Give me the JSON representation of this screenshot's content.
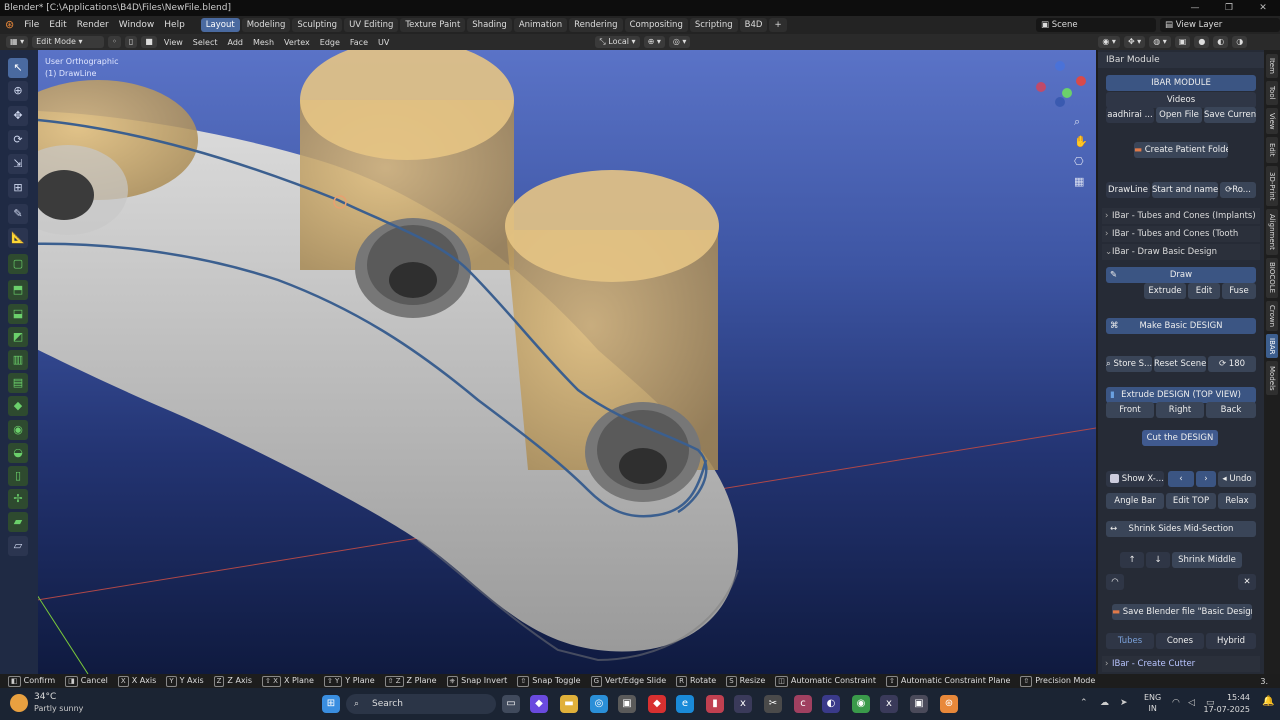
{
  "titlebar": {
    "title": "Blender* [C:\\Applications\\B4D\\Files\\NewFile.blend]",
    "minimize": "—",
    "maximize": "❐",
    "close": "✕"
  },
  "menus": [
    "File",
    "Edit",
    "Render",
    "Window",
    "Help"
  ],
  "workspace_tabs": [
    "Layout",
    "Modeling",
    "Sculpting",
    "UV Editing",
    "Texture Paint",
    "Shading",
    "Animation",
    "Rendering",
    "Compositing",
    "Scripting",
    "B4D"
  ],
  "add_tab": "+",
  "scene": {
    "label": "Scene",
    "view_layer": "View Layer"
  },
  "header": {
    "mode": "Edit Mode",
    "items": [
      "View",
      "Select",
      "Add",
      "Mesh",
      "Vertex",
      "Edge",
      "Face",
      "UV"
    ],
    "transform_orientation": "Local"
  },
  "viewport": {
    "view_name": "User Orthographic",
    "object_name": "(1) DrawLine"
  },
  "npanel": {
    "header": "IBar Module",
    "module_title": "IBAR MODULE",
    "videos": "Videos",
    "user": "aadhirai ...",
    "open_file": "Open File",
    "save_current": "Save Current",
    "create_patient_folder": "Create Patient Folder",
    "drawline": "DrawLine",
    "start_and_name": "Start and name H...",
    "ro": "Ro...",
    "sections": [
      "IBar - Tubes and Cones (Implants)",
      "IBar - Tubes and Cones (Tooth Preps)",
      "IBar - Draw Basic Design"
    ],
    "draw": "Draw",
    "extrude": "Extrude",
    "edit": "Edit",
    "fuse": "Fuse",
    "make_basic_design": "Make Basic DESIGN",
    "store_s": "Store S...",
    "reset_scene": "Reset Scene",
    "rotate_value": "180",
    "extrude_design": "Extrude DESIGN (TOP VIEW)",
    "front": "Front",
    "right": "Right",
    "back": "Back",
    "cut_design": "Cut the DESIGN",
    "show_x": "Show X-...",
    "undo": "Undo",
    "angle_bar": "Angle Bar",
    "edit_top": "Edit TOP",
    "relax": "Relax",
    "shrink_sides": "Shrink Sides Mid-Section",
    "shrink_middle": "Shrink Middle",
    "save_blender": "Save Blender file \"Basic Design\"",
    "tubes": "Tubes",
    "cones": "Cones",
    "hybrid": "Hybrid",
    "create_cutter": "IBar - Create Cutter",
    "vertical_tabs": [
      "Item",
      "Tool",
      "View",
      "Edit",
      "3D-Print",
      "Alignment",
      "BIOCOLE",
      "Crown",
      "IBAR",
      "Models"
    ]
  },
  "statusbar": [
    {
      "key": "",
      "label": "Confirm"
    },
    {
      "key": "",
      "label": "Cancel"
    },
    {
      "key": "X",
      "label": "X Axis"
    },
    {
      "key": "Y",
      "label": "Y Axis"
    },
    {
      "key": "Z",
      "label": "Z Axis"
    },
    {
      "key": "⇧ X",
      "label": "X Plane"
    },
    {
      "key": "⇧ Y",
      "label": "Y Plane"
    },
    {
      "key": "⇧ Z",
      "label": "Z Plane"
    },
    {
      "key": "",
      "label": "Snap Invert"
    },
    {
      "key": "⇧",
      "label": "Snap Toggle"
    },
    {
      "key": "G",
      "label": "Vert/Edge Slide"
    },
    {
      "key": "R",
      "label": "Rotate"
    },
    {
      "key": "S",
      "label": "Resize"
    },
    {
      "key": "",
      "label": "Automatic Constraint"
    },
    {
      "key": "⇧",
      "label": "Automatic Constraint Plane"
    },
    {
      "key": "",
      "label": "Precision Mode"
    }
  ],
  "status_end": "3.",
  "taskbar": {
    "weather_temp": "34°C",
    "weather_text": "Partly sunny",
    "search": "Search",
    "lang": "ENG",
    "region": "IN",
    "time": "15:44",
    "date": "17-07-2025"
  }
}
